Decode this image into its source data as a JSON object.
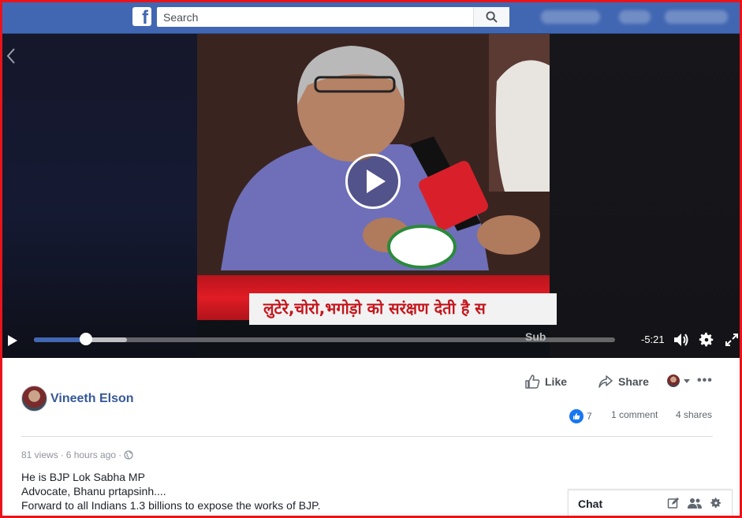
{
  "header": {
    "logo": "f",
    "search_placeholder": "Search",
    "icons": {
      "logo": "facebook-logo-icon",
      "search": "search-icon"
    },
    "colors": {
      "bar": "#4267b2"
    }
  },
  "video": {
    "ticker_text": "लुटेरे,चोरो,भगोड़ो को सरंक्षण देती है स",
    "time_remaining": "-5:21",
    "subtitle_toggle": "Sub",
    "progress": {
      "played_fraction": 0.09,
      "buffered_fraction": 0.16
    },
    "icons": {
      "back": "chevron-left-icon",
      "play_overlay": "play-circle-icon",
      "play": "play-icon",
      "volume": "volume-icon",
      "settings": "gear-icon",
      "fullscreen": "fullscreen-icon"
    }
  },
  "post": {
    "author": "Vineeth Elson",
    "actions": {
      "like": "Like",
      "share": "Share"
    },
    "reactions": {
      "likes": "7",
      "comments": "1 comment",
      "shares": "4 shares"
    },
    "meta": {
      "views": "81 views",
      "sep": "·",
      "time": "6 hours ago",
      "sep2": "·"
    },
    "description": [
      "He is BJP Lok Sabha MP",
      "Advocate, Bhanu prtapsinh....",
      "Forward to all Indians 1.3 billions to expose the works of BJP."
    ],
    "colors": {
      "author": "#365899",
      "like_badge": "#1877f2"
    }
  },
  "chat": {
    "label": "Chat",
    "icons": [
      "compose-icon",
      "contacts-icon",
      "gear-icon"
    ]
  }
}
